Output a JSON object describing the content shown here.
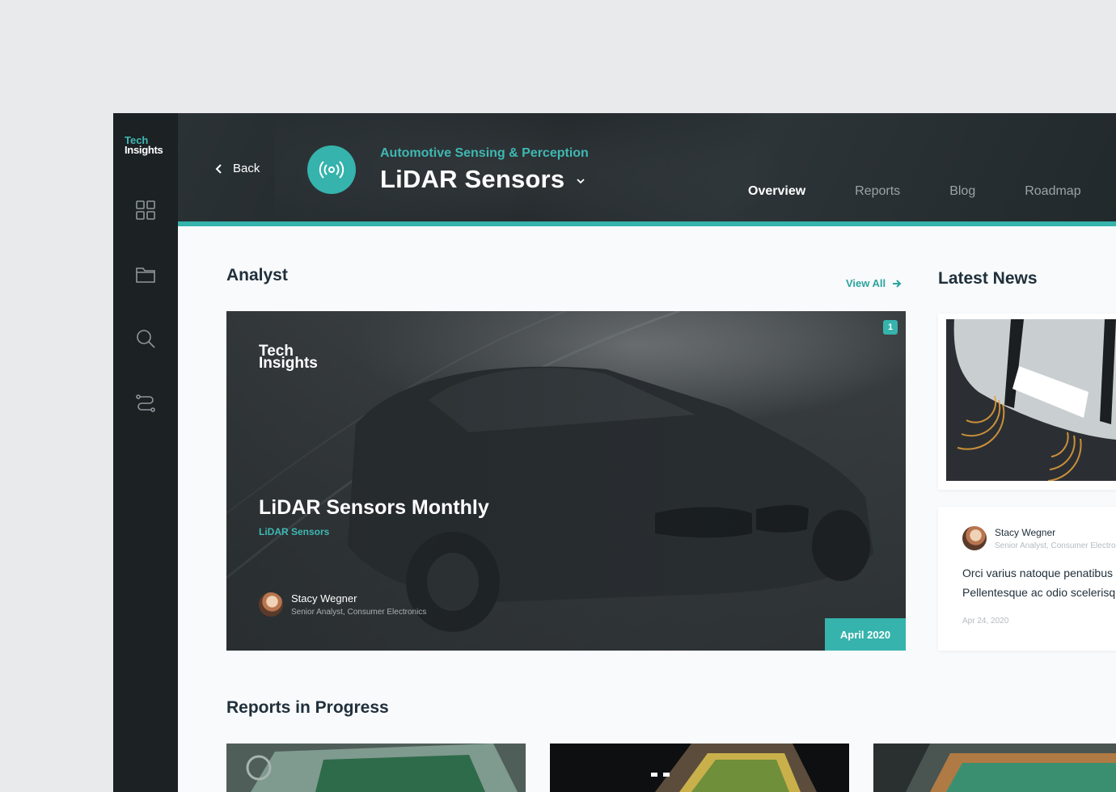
{
  "sidebar": {
    "logo": {
      "line1": "Tech",
      "line2": "Insights"
    },
    "items": [
      {
        "name": "grid-icon"
      },
      {
        "name": "folder-icon"
      },
      {
        "name": "search-icon"
      },
      {
        "name": "route-icon"
      }
    ]
  },
  "header": {
    "back_label": "Back",
    "category": "Automotive Sensing & Perception",
    "title": "LiDAR Sensors",
    "topic_icon": "signal-broadcast-icon",
    "tabs": [
      {
        "label": "Overview",
        "active": true
      },
      {
        "label": "Reports",
        "active": false
      },
      {
        "label": "Blog",
        "active": false
      },
      {
        "label": "Roadmap",
        "active": false
      }
    ]
  },
  "analyst": {
    "section_title": "Analyst",
    "view_all": "View All",
    "hero": {
      "logo_line1": "Tech",
      "logo_line2": "Insights",
      "title": "LiDAR Sensors Monthly",
      "tag": "LiDAR Sensors",
      "count": "1",
      "author_name": "Stacy Wegner",
      "author_role": "Senior Analyst, Consumer Electronics",
      "date": "April 2020"
    }
  },
  "news": {
    "section_title": "Latest News",
    "item": {
      "author_name": "Stacy Wegner",
      "author_role": "Senior Analyst, Consumer Electronics",
      "line1": "Orci varius natoque penatibus",
      "line2": "Pellentesque ac odio scelerisque",
      "date": "Apr 24, 2020"
    }
  },
  "reports": {
    "section_title": "Reports in Progress"
  },
  "colors": {
    "accent": "#35b3ac",
    "sidebar": "#1c2124",
    "heading": "#20303b"
  }
}
